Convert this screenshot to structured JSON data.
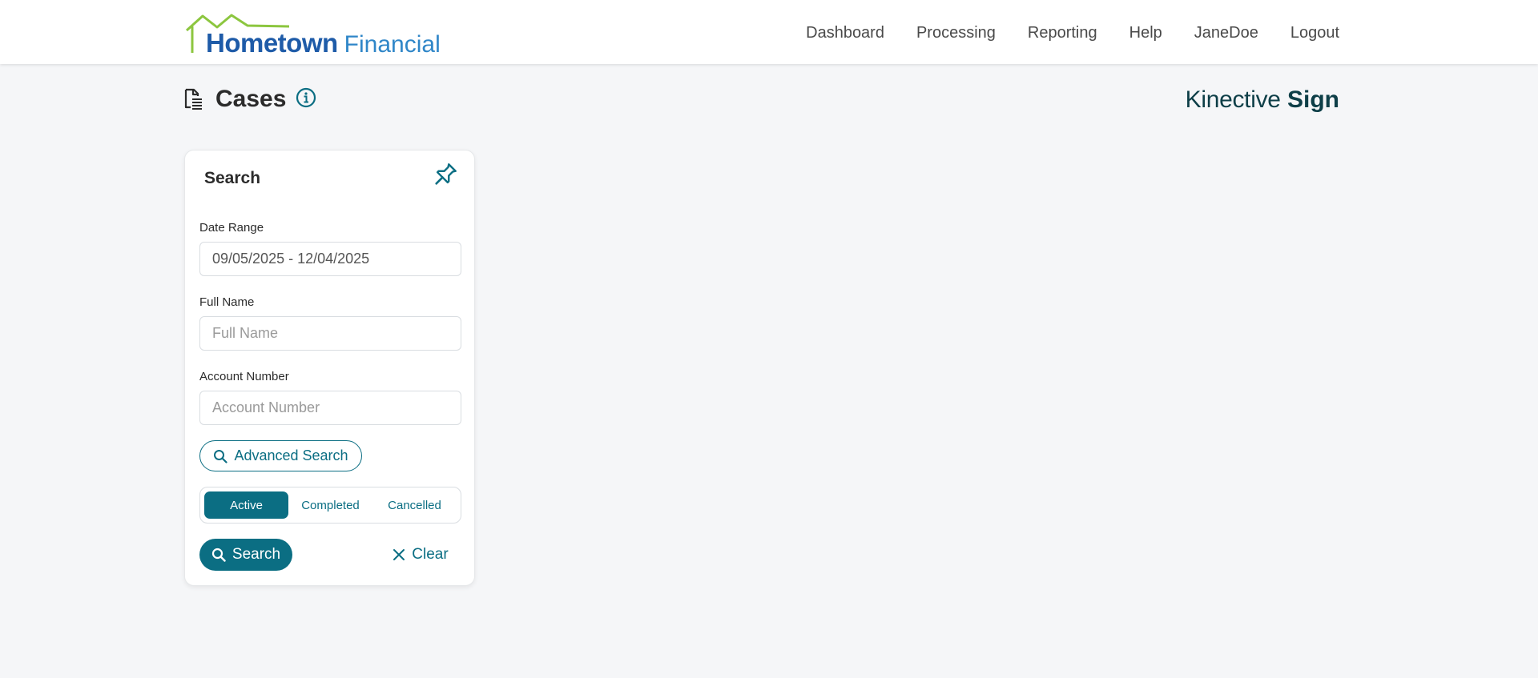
{
  "header": {
    "logo": {
      "main": "Hometown",
      "sub": "Financial"
    },
    "nav": [
      {
        "label": "Dashboard"
      },
      {
        "label": "Processing"
      },
      {
        "label": "Reporting"
      },
      {
        "label": "Help"
      },
      {
        "label": "JaneDoe"
      },
      {
        "label": "Logout"
      }
    ]
  },
  "page": {
    "title": "Cases",
    "title_icon": "document-list-icon",
    "info_icon": "info-icon",
    "brand": {
      "light": "Kinective",
      "bold": "Sign"
    }
  },
  "search_panel": {
    "title": "Search",
    "pin_icon": "pin-icon",
    "date_range": {
      "label": "Date Range",
      "value": "09/05/2025 - 12/04/2025"
    },
    "full_name": {
      "label": "Full Name",
      "placeholder": "Full Name",
      "value": ""
    },
    "account_number": {
      "label": "Account Number",
      "placeholder": "Account Number",
      "value": ""
    },
    "advanced_search_label": "Advanced Search",
    "status_tabs": [
      {
        "label": "Active",
        "selected": true
      },
      {
        "label": "Completed",
        "selected": false
      },
      {
        "label": "Cancelled",
        "selected": false
      }
    ],
    "search_label": "Search",
    "clear_label": "Clear"
  },
  "colors": {
    "accent": "#0b6e83",
    "logo_blue": "#1e5ba8",
    "logo_green": "#8cc63f",
    "brand_dark": "#0e3f48",
    "background": "#f5f6f8"
  }
}
